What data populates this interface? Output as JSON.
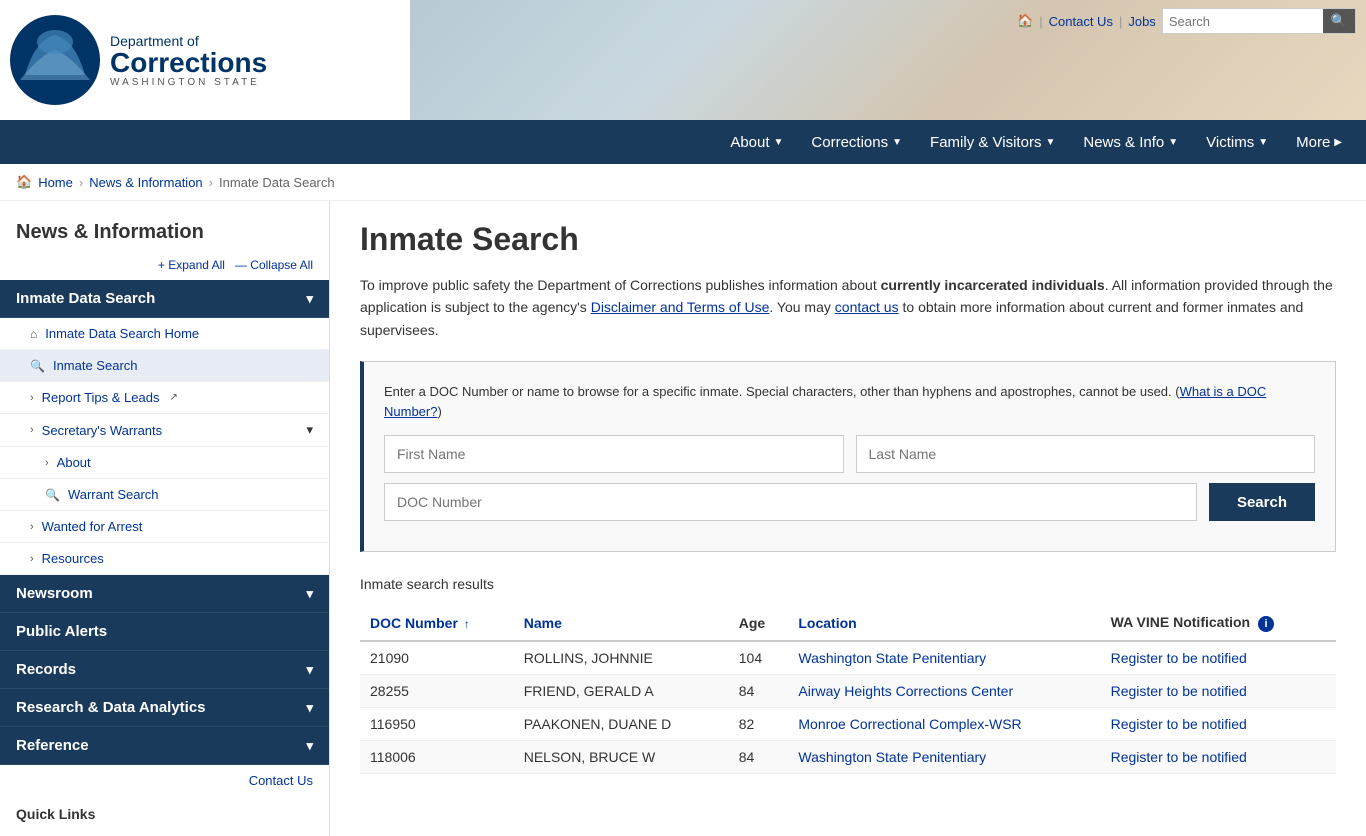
{
  "header": {
    "home_icon": "🏠",
    "contact_us": "Contact Us",
    "jobs": "Jobs",
    "search_placeholder": "Search",
    "logo_dept": "Department of",
    "logo_name": "Corrections",
    "logo_state": "WASHINGTON STATE"
  },
  "nav": {
    "items": [
      {
        "label": "About",
        "has_dropdown": true
      },
      {
        "label": "Corrections",
        "has_dropdown": true
      },
      {
        "label": "Family & Visitors",
        "has_dropdown": true
      },
      {
        "label": "News & Info",
        "has_dropdown": true
      },
      {
        "label": "Victims",
        "has_dropdown": true
      },
      {
        "label": "More",
        "has_dropdown": true
      }
    ]
  },
  "breadcrumb": {
    "home": "Home",
    "news_info": "News & Information",
    "current": "Inmate Data Search"
  },
  "sidebar": {
    "title": "News & Information",
    "expand_all": "+ Expand All",
    "collapse_all": "— Collapse All",
    "menu_items": [
      {
        "label": "Inmate Data Search",
        "active": true,
        "expanded": true,
        "sub_items": [
          {
            "icon": "home",
            "label": "Inmate Data Search Home",
            "indent": 1
          },
          {
            "icon": "search",
            "label": "Inmate Search",
            "indent": 1,
            "active": true
          },
          {
            "icon": "expand",
            "label": "Report Tips & Leads",
            "indent": 1,
            "external": true
          },
          {
            "icon": "expand",
            "label": "Secretary's Warrants",
            "indent": 1,
            "has_sub": true,
            "children": [
              {
                "icon": "expand",
                "label": "About"
              },
              {
                "icon": "search",
                "label": "Warrant Search"
              }
            ]
          },
          {
            "icon": "expand",
            "label": "Wanted for Arrest",
            "indent": 1
          },
          {
            "icon": "expand",
            "label": "Resources",
            "indent": 1
          }
        ]
      },
      {
        "label": "Newsroom",
        "active": false,
        "expanded": false
      },
      {
        "label": "Public Alerts",
        "active": false,
        "expanded": false,
        "no_arrow": true
      },
      {
        "label": "Records",
        "active": false,
        "expanded": false
      },
      {
        "label": "Research & Data Analytics",
        "active": false,
        "expanded": false
      },
      {
        "label": "Reference",
        "active": false,
        "expanded": false
      }
    ],
    "contact_us": "Contact Us",
    "quick_links": "Quick Links"
  },
  "content": {
    "page_title": "Inmate Search",
    "intro": "To improve public safety the Department of Corrections publishes information about ",
    "intro_bold": "currently incarcerated individuals",
    "intro_cont": ". All information provided through the application is subject to the agency's ",
    "disclaimer_link": "Disclaimer and Terms of Use",
    "intro_cont2": ". You may ",
    "contact_link": "contact us",
    "intro_cont3": " to obtain more information about current and former inmates and supervisees.",
    "search_desc": "Enter a DOC Number or name to browse for a specific inmate. Special characters, other than hyphens and apostrophes, cannot be used. (",
    "what_is_doc": "What is a DOC Number?",
    "search_desc_end": ")",
    "first_name_placeholder": "First Name",
    "last_name_placeholder": "Last Name",
    "doc_number_placeholder": "DOC Number",
    "search_button": "Search",
    "results_title": "Inmate search results",
    "table": {
      "headers": [
        {
          "label": "DOC Number",
          "sortable": true,
          "sort_dir": "asc"
        },
        {
          "label": "Name",
          "sortable": true
        },
        {
          "label": "Age",
          "sortable": false
        },
        {
          "label": "Location",
          "sortable": true
        },
        {
          "label": "WA VINE Notification",
          "sortable": false,
          "has_info": true
        }
      ],
      "rows": [
        {
          "doc": "21090",
          "name": "ROLLINS, JOHNNIE",
          "age": "104",
          "location": "Washington State Penitentiary",
          "vine": "Register to be notified"
        },
        {
          "doc": "28255",
          "name": "FRIEND, GERALD A",
          "age": "84",
          "location": "Airway Heights Corrections Center",
          "vine": "Register to be notified"
        },
        {
          "doc": "116950",
          "name": "PAAKONEN, DUANE D",
          "age": "82",
          "location": "Monroe Correctional Complex-WSR",
          "vine": "Register to be notified"
        },
        {
          "doc": "118006",
          "name": "NELSON, BRUCE W",
          "age": "84",
          "location": "Washington State Penitentiary",
          "vine": "Register to be notified"
        }
      ]
    }
  },
  "colors": {
    "nav_bg": "#1a3a5c",
    "link": "#003399",
    "accent": "#1a3a5c"
  }
}
